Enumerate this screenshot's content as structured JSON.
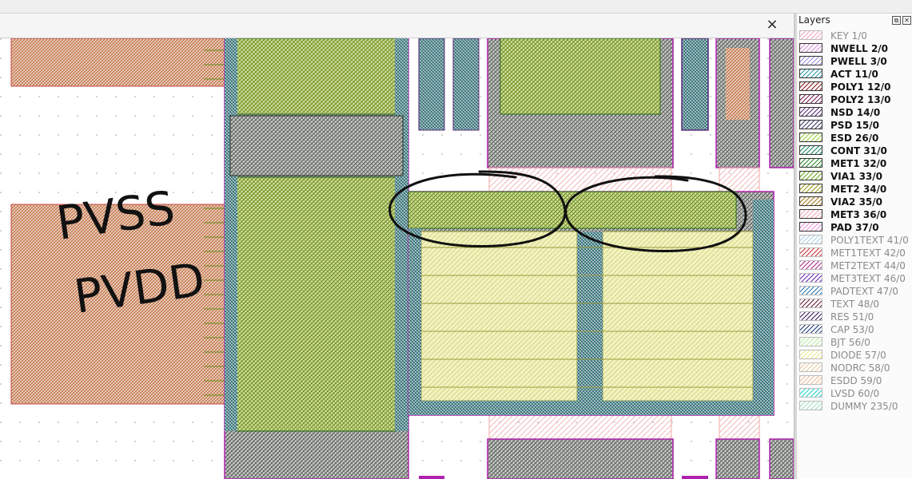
{
  "window": {
    "close_icon": "×"
  },
  "layers_panel": {
    "title": "Layers",
    "float_icon": "⧉",
    "close_icon": "✕",
    "items": [
      {
        "label": "KEY 1/0",
        "color": "#f2a5c0",
        "visible": false
      },
      {
        "label": "NWELL 2/0",
        "color": "#d98fd9",
        "visible": true
      },
      {
        "label": "PWELL 3/0",
        "color": "#9a8fd9",
        "visible": true
      },
      {
        "label": "ACT 11/0",
        "color": "#2a9aa8",
        "visible": true
      },
      {
        "label": "POLY1 12/0",
        "color": "#8a1a1a",
        "visible": true
      },
      {
        "label": "POLY2 13/0",
        "color": "#7a1f5a",
        "visible": true
      },
      {
        "label": "NSD 14/0",
        "color": "#5a2a7a",
        "visible": true
      },
      {
        "label": "PSD 15/0",
        "color": "#3a3a6a",
        "visible": true
      },
      {
        "label": "ESD 26/0",
        "color": "#9ad23a",
        "visible": true
      },
      {
        "label": "CONT 31/0",
        "color": "#1a8a6a",
        "visible": true
      },
      {
        "label": "MET1 32/0",
        "color": "#2a8a2a",
        "visible": true
      },
      {
        "label": "VIA1 33/0",
        "color": "#6aa81a",
        "visible": true
      },
      {
        "label": "MET2 34/0",
        "color": "#9a9a1a",
        "visible": true
      },
      {
        "label": "VIA2 35/0",
        "color": "#a8781a",
        "visible": true
      },
      {
        "label": "MET3 36/0",
        "color": "#f0a8b0",
        "visible": true
      },
      {
        "label": "PAD 37/0",
        "color": "#e890d8",
        "visible": true
      },
      {
        "label": "POLY1TEXT 41/0",
        "color": "#a8d0e8",
        "visible": false
      },
      {
        "label": "MET1TEXT 42/0",
        "color": "#c83030",
        "visible": false
      },
      {
        "label": "MET2TEXT 44/0",
        "color": "#b02a8a",
        "visible": false
      },
      {
        "label": "MET3TEXT 46/0",
        "color": "#6a2ab0",
        "visible": false
      },
      {
        "label": "PADTEXT 47/0",
        "color": "#2a78b0",
        "visible": false
      },
      {
        "label": "TEXT 48/0",
        "color": "#6a1a3a",
        "visible": false
      },
      {
        "label": "RES 51/0",
        "color": "#3a1a5a",
        "visible": false
      },
      {
        "label": "CAP 53/0",
        "color": "#1a3a7a",
        "visible": false
      },
      {
        "label": "BJT 56/0",
        "color": "#b8e8a0",
        "visible": false
      },
      {
        "label": "DIODE 57/0",
        "color": "#e8e890",
        "visible": false
      },
      {
        "label": "NODRC 58/0",
        "color": "#e8c8a0",
        "visible": false
      },
      {
        "label": "ESDD 59/0",
        "color": "#e8b890",
        "visible": false
      },
      {
        "label": "LVSD 60/0",
        "color": "#20d0d0",
        "visible": false
      },
      {
        "label": "DUMMY 235/0",
        "color": "#a0e0c0",
        "visible": false
      }
    ]
  },
  "canvas": {
    "annotation_circled_count": 2,
    "handwriting_line1": "PVSS",
    "handwriting_line2": "PVDD"
  }
}
